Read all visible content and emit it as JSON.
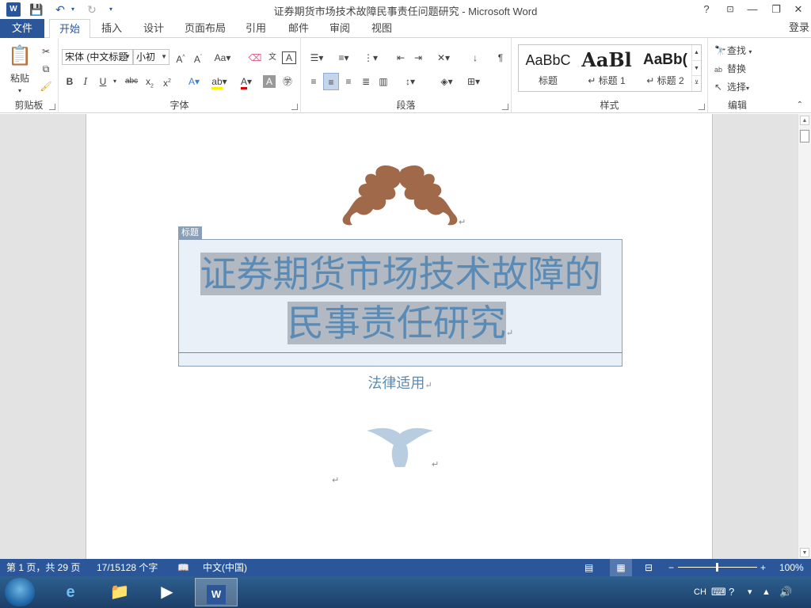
{
  "window": {
    "title": "证券期货市场技术故障民事责任问题研究 - Microsoft Word",
    "app_icon": "W",
    "help": "?",
    "minimize": "—",
    "restore": "❐",
    "close": "✕"
  },
  "tabs": {
    "file": "文件",
    "items": [
      "开始",
      "插入",
      "设计",
      "页面布局",
      "引用",
      "邮件",
      "审阅",
      "视图"
    ],
    "active": "开始",
    "login": "登录"
  },
  "ribbon": {
    "clipboard": {
      "label": "剪贴板",
      "paste": "粘贴"
    },
    "font": {
      "label": "字体",
      "font_name": "宋体 (中文标题",
      "font_size": "小初"
    },
    "paragraph": {
      "label": "段落"
    },
    "styles": {
      "label": "样式",
      "items": [
        {
          "sample": "AaBbC",
          "name": "标题"
        },
        {
          "sample": "AaBl",
          "name": "↵ 标题 1"
        },
        {
          "sample": "AaBb(",
          "name": "↵ 标题 2"
        }
      ]
    },
    "editing": {
      "label": "编辑",
      "find": "查找",
      "replace": "替换",
      "select": "选择"
    }
  },
  "document": {
    "title_tag": "标题",
    "title_line1": "证券期货市场技术故障的",
    "title_line2": "民事责任研究",
    "subtitle": "法律适用",
    "para_mark": "↵"
  },
  "status": {
    "page": "第 1 页，共 29 页",
    "words": "17/15128 个字",
    "language": "中文(中国)",
    "zoom": "100%",
    "zoom_level": 1.0
  },
  "taskbar": {
    "ime": "CH"
  },
  "colors": {
    "accent": "#2b579a",
    "title_text": "#5b8bb4",
    "ornament": "#a06a4a"
  }
}
